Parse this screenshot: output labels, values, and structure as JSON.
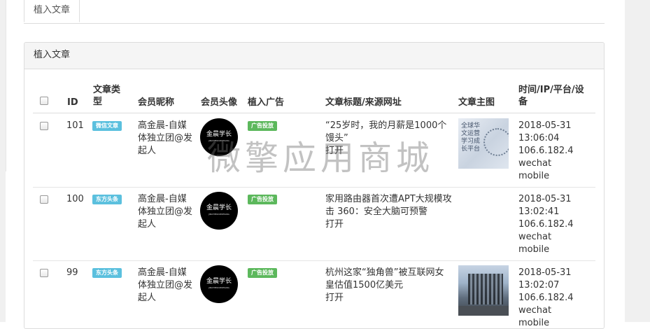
{
  "tab": {
    "label": "植入文章"
  },
  "panel": {
    "title": "植入文章"
  },
  "table": {
    "headers": {
      "id": "ID",
      "type_line1": "文章类",
      "type_line2": "型",
      "nickname": "会员昵称",
      "avatar": "会员头像",
      "ad": "植入广告",
      "title": "文章标题/来源网址",
      "image": "文章主图",
      "meta_line1": "时间/IP/平台/设",
      "meta_line2": "备"
    },
    "rows": [
      {
        "id": "101",
        "type": "微信文章",
        "nickname_lines": [
          "高金晨-自媒",
          "体独立团@发",
          "起人"
        ],
        "avatar_text": "金晨学长",
        "avatar_sub": "JINCHENXUEZHANG",
        "ad": "广告投放",
        "title_lines": [
          "“25岁时，我的月薪是1000个",
          "馒头”"
        ],
        "open": "打开",
        "image_text": "全球华文运营学习成长平台",
        "date": "2018-05-31",
        "time": "13:06:04",
        "ip": "106.6.182.4",
        "platform": "wechat",
        "device": "mobile"
      },
      {
        "id": "100",
        "type": "东方头条",
        "nickname_lines": [
          "高金晨-自媒",
          "体独立团@发",
          "起人"
        ],
        "avatar_text": "金晨学长",
        "avatar_sub": "JINCHENXUEZHANG",
        "ad": "广告投放",
        "title_lines": [
          "家用路由器首次遭APT大规模攻",
          "击 360：安全大脑可预警"
        ],
        "open": "打开",
        "date": "2018-05-31",
        "time": "13:02:41",
        "ip": "106.6.182.4",
        "platform": "wechat",
        "device": "mobile"
      },
      {
        "id": "99",
        "type": "东方头条",
        "nickname_lines": [
          "高金晨-自媒",
          "体独立团@发",
          "起人"
        ],
        "avatar_text": "金晨学长",
        "avatar_sub": "JINCHENXUEZHANG",
        "ad": "广告投放",
        "title_lines": [
          "杭州这家“独角兽”被互联网女",
          "皇估值1500亿美元"
        ],
        "open": "打开",
        "date": "2018-05-31",
        "time": "13:02:07",
        "ip": "106.6.182.4",
        "platform": "wechat",
        "device": "mobile"
      }
    ]
  },
  "watermark": "微擎应用商城",
  "colors": {
    "info_badge": "#5bc0de",
    "success_badge": "#5cb85c",
    "panel_heading_bg": "#f5f5f5",
    "border": "#dddddd"
  }
}
